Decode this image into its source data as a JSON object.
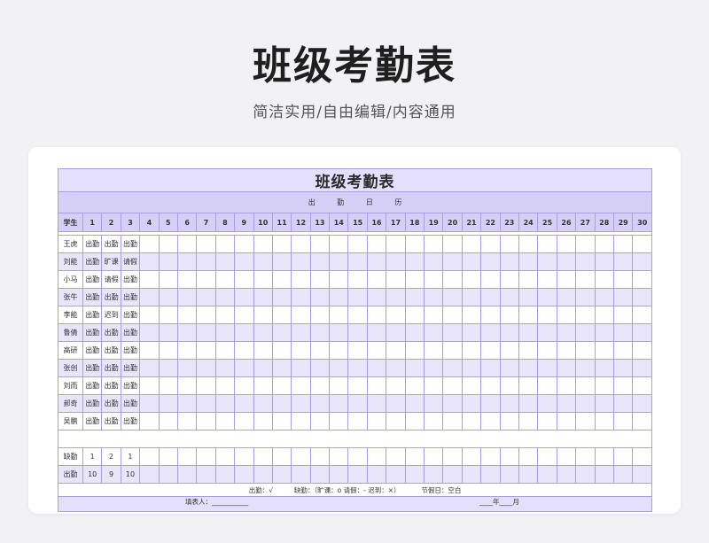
{
  "page_title": "班级考勤表",
  "page_subtitle": "简洁实用/自由编辑/内容通用",
  "sheet": {
    "title": "班级考勤表",
    "calendar_label": "出 勤 日 历",
    "student_header": "学生",
    "days": [
      "1",
      "2",
      "3",
      "4",
      "5",
      "6",
      "7",
      "8",
      "9",
      "10",
      "11",
      "12",
      "13",
      "14",
      "15",
      "16",
      "17",
      "18",
      "19",
      "20",
      "21",
      "22",
      "23",
      "24",
      "25",
      "26",
      "27",
      "28",
      "29",
      "30"
    ],
    "students": [
      {
        "name": "王虎",
        "marks": [
          "出勤",
          "出勤",
          "出勤"
        ]
      },
      {
        "name": "刘能",
        "marks": [
          "出勤",
          "旷课",
          "请假"
        ]
      },
      {
        "name": "小马",
        "marks": [
          "出勤",
          "请假",
          "出勤"
        ]
      },
      {
        "name": "张牛",
        "marks": [
          "出勤",
          "出勤",
          "出勤"
        ]
      },
      {
        "name": "李能",
        "marks": [
          "出勤",
          "迟到",
          "出勤"
        ]
      },
      {
        "name": "鲁倩",
        "marks": [
          "出勤",
          "出勤",
          "出勤"
        ]
      },
      {
        "name": "高研",
        "marks": [
          "出勤",
          "出勤",
          "出勤"
        ]
      },
      {
        "name": "张创",
        "marks": [
          "出勤",
          "出勤",
          "出勤"
        ]
      },
      {
        "name": "刘而",
        "marks": [
          "出勤",
          "出勤",
          "出勤"
        ]
      },
      {
        "name": "郝奇",
        "marks": [
          "出勤",
          "出勤",
          "出勤"
        ]
      },
      {
        "name": "吴鹏",
        "marks": [
          "出勤",
          "出勤",
          "出勤"
        ]
      }
    ],
    "summary": [
      {
        "label": "缺勤",
        "values": [
          "1",
          "2",
          "1"
        ]
      },
      {
        "label": "出勤",
        "values": [
          "10",
          "9",
          "10"
        ]
      }
    ],
    "legend": "出勤：√          缺勤：（旷课：o 请假：- 迟到：×）          节假日：空白",
    "filler_label": "填表人：___________",
    "date_label": "____年____月"
  }
}
